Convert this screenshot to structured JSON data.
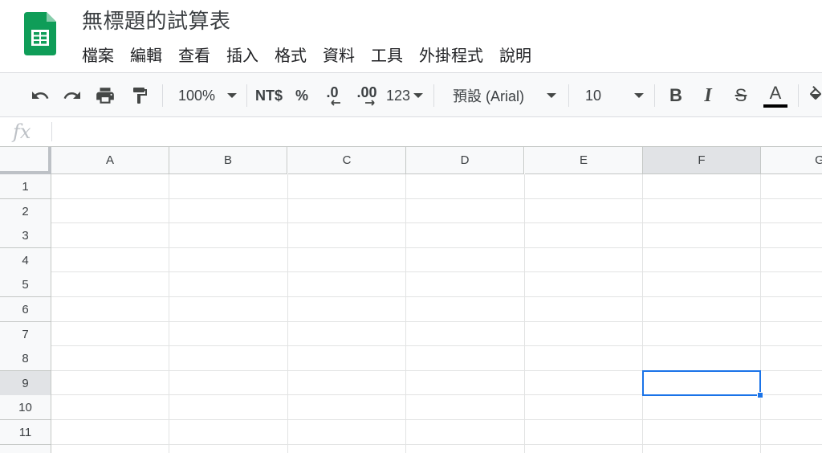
{
  "document": {
    "title": "無標題的試算表"
  },
  "menu": [
    "檔案",
    "編輯",
    "查看",
    "插入",
    "格式",
    "資料",
    "工具",
    "外掛程式",
    "說明"
  ],
  "toolbar": {
    "zoom": "100%",
    "currency": "NT$",
    "percent": "%",
    "decrease_decimal": ".0",
    "increase_decimal": ".00",
    "number_format": "123",
    "font": "預設 (Arial)",
    "font_size": "10",
    "bold": "B",
    "italic": "I",
    "strikethrough": "S",
    "text_color_label": "A",
    "text_color": "#000000"
  },
  "formula_bar": {
    "label": "fx",
    "value": ""
  },
  "grid": {
    "columns": [
      "A",
      "B",
      "C",
      "D",
      "E",
      "F",
      "G"
    ],
    "rows": [
      "1",
      "2",
      "3",
      "4",
      "5",
      "6",
      "7",
      "8",
      "9",
      "10",
      "11"
    ],
    "selected_cell": {
      "column": "F",
      "row": "9"
    }
  },
  "colors": {
    "logo_green": "#0f9d58",
    "selection_blue": "#1a73e8",
    "header_bg": "#f8f9fa"
  }
}
